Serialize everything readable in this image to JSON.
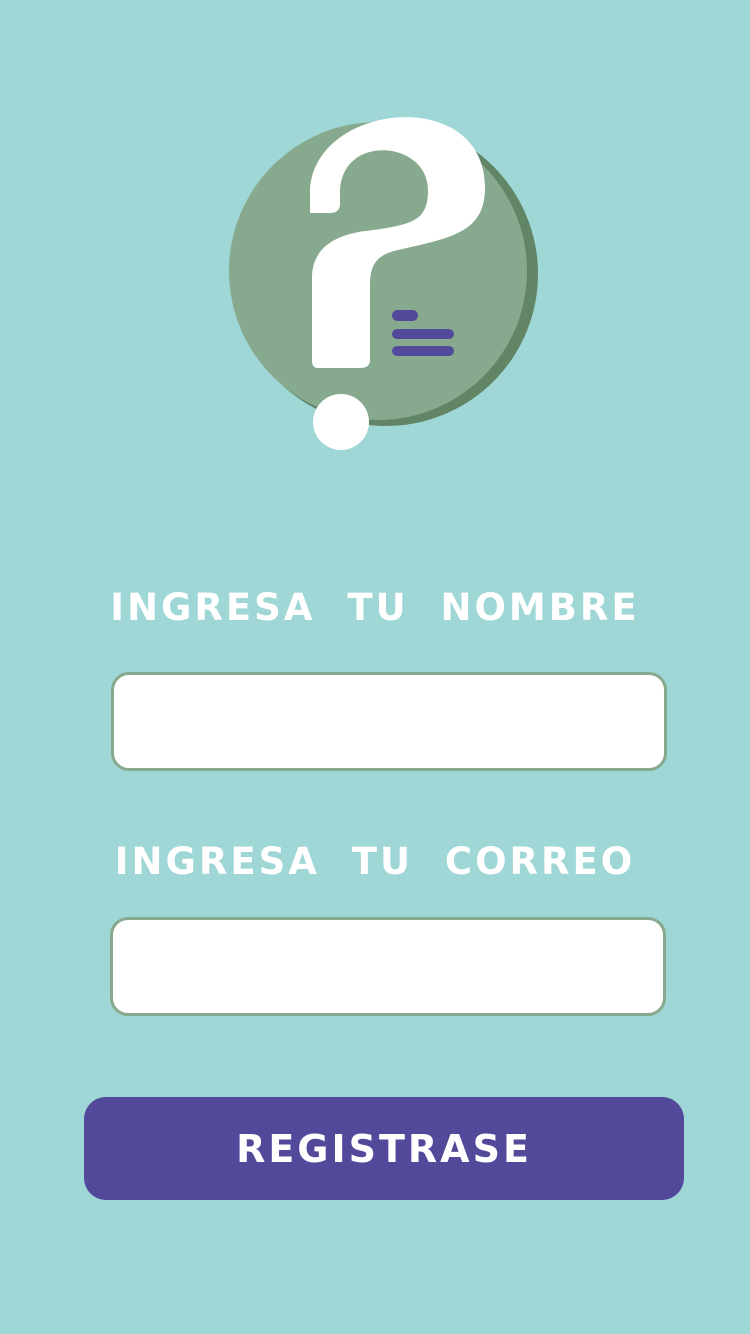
{
  "logo": {
    "icon": "question-mark-circle-icon",
    "colors": {
      "circle": "#87a98d",
      "circle_shadow": "#628566",
      "question_mark": "#ffffff",
      "lines": "#52499b"
    }
  },
  "form": {
    "name_label": "INGRESA TU NOMBRE",
    "name_value": "",
    "email_label": "INGRESA TU CORREO",
    "email_value": "",
    "submit_label": "REGISTRASE"
  },
  "colors": {
    "background": "#9fd6d6",
    "button": "#52499b",
    "input_border": "#87a98d",
    "label_text": "#ffffff"
  }
}
